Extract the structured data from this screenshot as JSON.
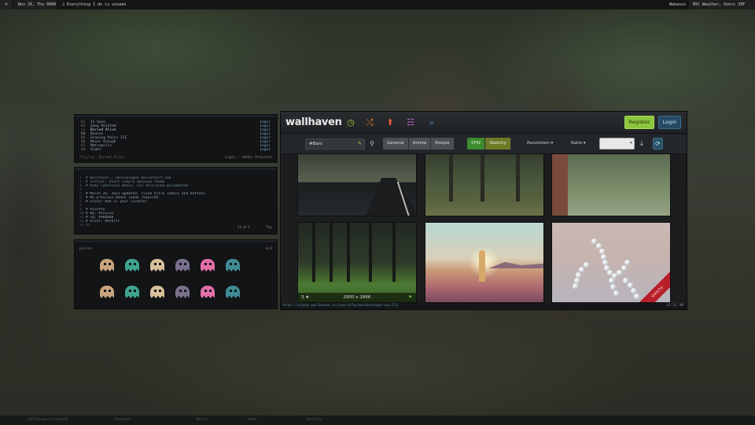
{
  "topbar": {
    "logo": "⌘",
    "date": "Nov 26, Thu 0000",
    "song": "♫ Everything I do is unseen",
    "user": "Wakesus",
    "weather": "NYC Weather, Overc 39F"
  },
  "bottombar": {
    "items": [
      "wallhaven.cc/search",
      "Terminal",
      "Music",
      "Code",
      "Sprites"
    ]
  },
  "playlist": {
    "songs": [
      {
        "num": "01",
        "title": "In Gone",
        "artist": "Logic"
      },
      {
        "num": "02",
        "title": "Gang Related",
        "artist": "Logic"
      },
      {
        "num": ">> 03",
        "title": "Buried Alive",
        "artist": "Logic"
      },
      {
        "num": "04",
        "title": "Bounce",
        "artist": "Logic"
      },
      {
        "num": "05",
        "title": "Growing Pains III",
        "artist": "Logic"
      },
      {
        "num": "06",
        "title": "Never Enough",
        "artist": "Logic"
      },
      {
        "num": "07",
        "title": "Metropolis",
        "artist": "Logic"
      },
      {
        "num": "08",
        "title": "Sides",
        "artist": "Logic"
      }
    ],
    "now_label": "Playing",
    "now_title": "Buried Alive",
    "now_right": "Logic — Under Pressure"
  },
  "editor": {
    "lines": [
      "# Wallhaven | abnixusagan.deviantart.com",
      "# Initial: Vimrc simple ApexSub Theme",
      "# Ruby Comtesse2 Bonus, CSS Versioned Documented",
      "",
      "# March 26, 2013 updated. Fixed title labels and buttons.",
      "# No previous About Tweak required",
      "# Enjoy! Red is your license!",
      "",
      "# Palette",
      "# Bg:    #151515",
      "# Fg:    #d0d0d0",
      "# Accnt: #8fbf5f",
      "[]"
    ],
    "position": "13,0-1",
    "scroll": "Top"
  },
  "sprites": {
    "title": "ponies",
    "count": "0/8",
    "colors": [
      "#c8a57e",
      "#3fa58f",
      "#d9c09a",
      "#7a708c",
      "#e36fa8",
      "#3f8b96",
      "#c8a57e",
      "#3fa58f",
      "#d9c09a",
      "#7a708c",
      "#e36fa8",
      "#3f8b96"
    ]
  },
  "wallhaven": {
    "logo": "wallhaven",
    "icons": [
      {
        "name": "latest-icon",
        "glyph": "◷",
        "color": "#9bd12e"
      },
      {
        "name": "random-icon",
        "glyph": "⤮",
        "color": "#f0792a"
      },
      {
        "name": "upload-icon",
        "glyph": "⬆",
        "color": "#f15a3c"
      },
      {
        "name": "forums-icon",
        "glyph": "☵",
        "color": "#c66ad6"
      },
      {
        "name": "search-nav-icon",
        "glyph": "⌕",
        "color": "#42a7e6"
      }
    ],
    "register_label": "Register",
    "login_label": "Login",
    "search_value": "#Bars",
    "categories": [
      "General",
      "Anime",
      "People"
    ],
    "purity": [
      "SFW",
      "Sketchy"
    ],
    "resolution_label": "Resolution ▾",
    "ratio_label": "Ratio ▾",
    "thumb4_favs": "3 ★",
    "thumb4_resolution": "2950 x 1666",
    "sketchy_ribbon": "sketchy",
    "status_url": "http://alpha.wallhaven.cc/search?q=bars&categories=111",
    "status_right": "11:11 AM"
  }
}
